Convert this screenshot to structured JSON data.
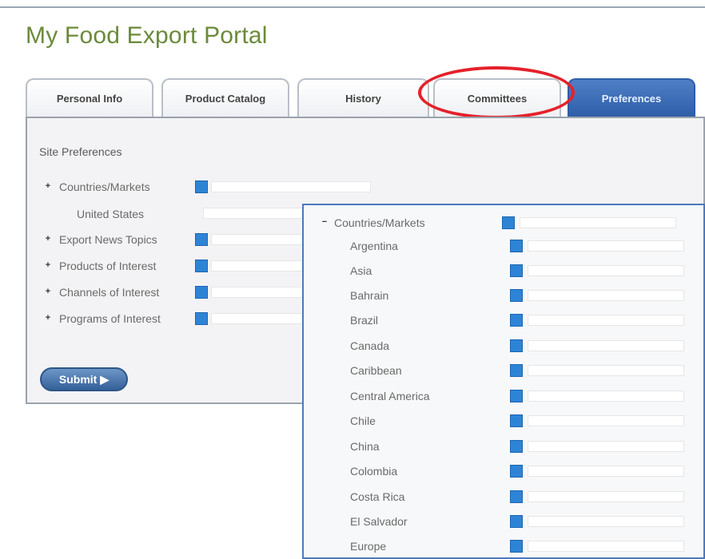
{
  "header": {
    "title": "My Food Export Portal"
  },
  "tabs": [
    {
      "label": "Personal Info"
    },
    {
      "label": "Product Catalog"
    },
    {
      "label": "History"
    },
    {
      "label": "Committees"
    },
    {
      "label": "Preferences"
    }
  ],
  "preferences": {
    "heading": "Site Preferences",
    "rows": [
      {
        "label": "Countries/Markets",
        "expander": "+"
      },
      {
        "label": "Export News Topics",
        "expander": "+"
      },
      {
        "label": "Products of Interest",
        "expander": "+"
      },
      {
        "label": "Channels of Interest",
        "expander": "+"
      },
      {
        "label": "Programs of Interest",
        "expander": "+"
      }
    ],
    "selected_country": "United States",
    "submit_label": "Submit"
  },
  "popup": {
    "header_label": "Countries/Markets",
    "header_expander": "−",
    "items": [
      {
        "label": "Argentina"
      },
      {
        "label": "Asia"
      },
      {
        "label": "Bahrain"
      },
      {
        "label": "Brazil"
      },
      {
        "label": "Canada"
      },
      {
        "label": "Caribbean"
      },
      {
        "label": "Central America"
      },
      {
        "label": "Chile"
      },
      {
        "label": "China"
      },
      {
        "label": "Colombia"
      },
      {
        "label": "Costa Rica"
      },
      {
        "label": "El Salvador"
      },
      {
        "label": "Europe"
      }
    ]
  },
  "colors": {
    "title_green": "#6b8a3a",
    "active_tab": "#2e5ea8",
    "checkbox_blue": "#2d84d6",
    "highlight_circle": "#e5212a"
  }
}
